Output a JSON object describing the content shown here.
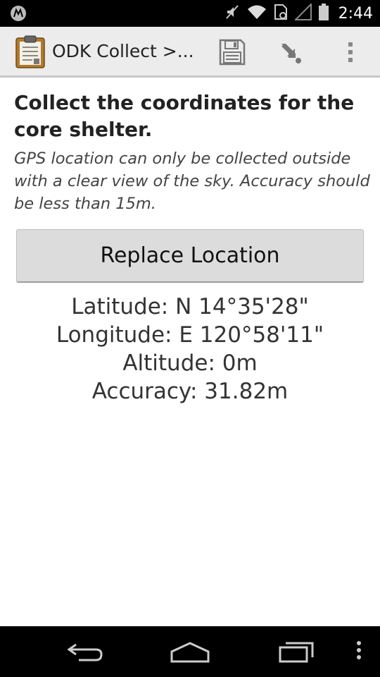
{
  "status_bar": {
    "time": "2:44",
    "icons": [
      "motorola-logo-icon",
      "mute-icon",
      "wifi-icon",
      "sim-card-icon",
      "signal-icon",
      "battery-icon"
    ]
  },
  "action_bar": {
    "title": "ODK Collect >...",
    "app_icon": "clipboard-icon",
    "actions": [
      "save-icon",
      "jump-to-question-icon",
      "overflow-menu-icon"
    ]
  },
  "question": {
    "label": "Collect the coordinates for the core shelter.",
    "hint": "GPS location can only be collected outside with a clear view of the sky. Accuracy should be less than 15m."
  },
  "replace_button": {
    "label": "Replace Location"
  },
  "location": {
    "latitude": "Latitude: N 14°35'28\"",
    "longitude": "Longitude: E 120°58'11\"",
    "altitude": "Altitude: 0m",
    "accuracy": "Accuracy: 31.82m"
  },
  "nav_bar": {
    "buttons": [
      "back-icon",
      "home-icon",
      "recent-apps-icon",
      "menu-icon"
    ]
  }
}
